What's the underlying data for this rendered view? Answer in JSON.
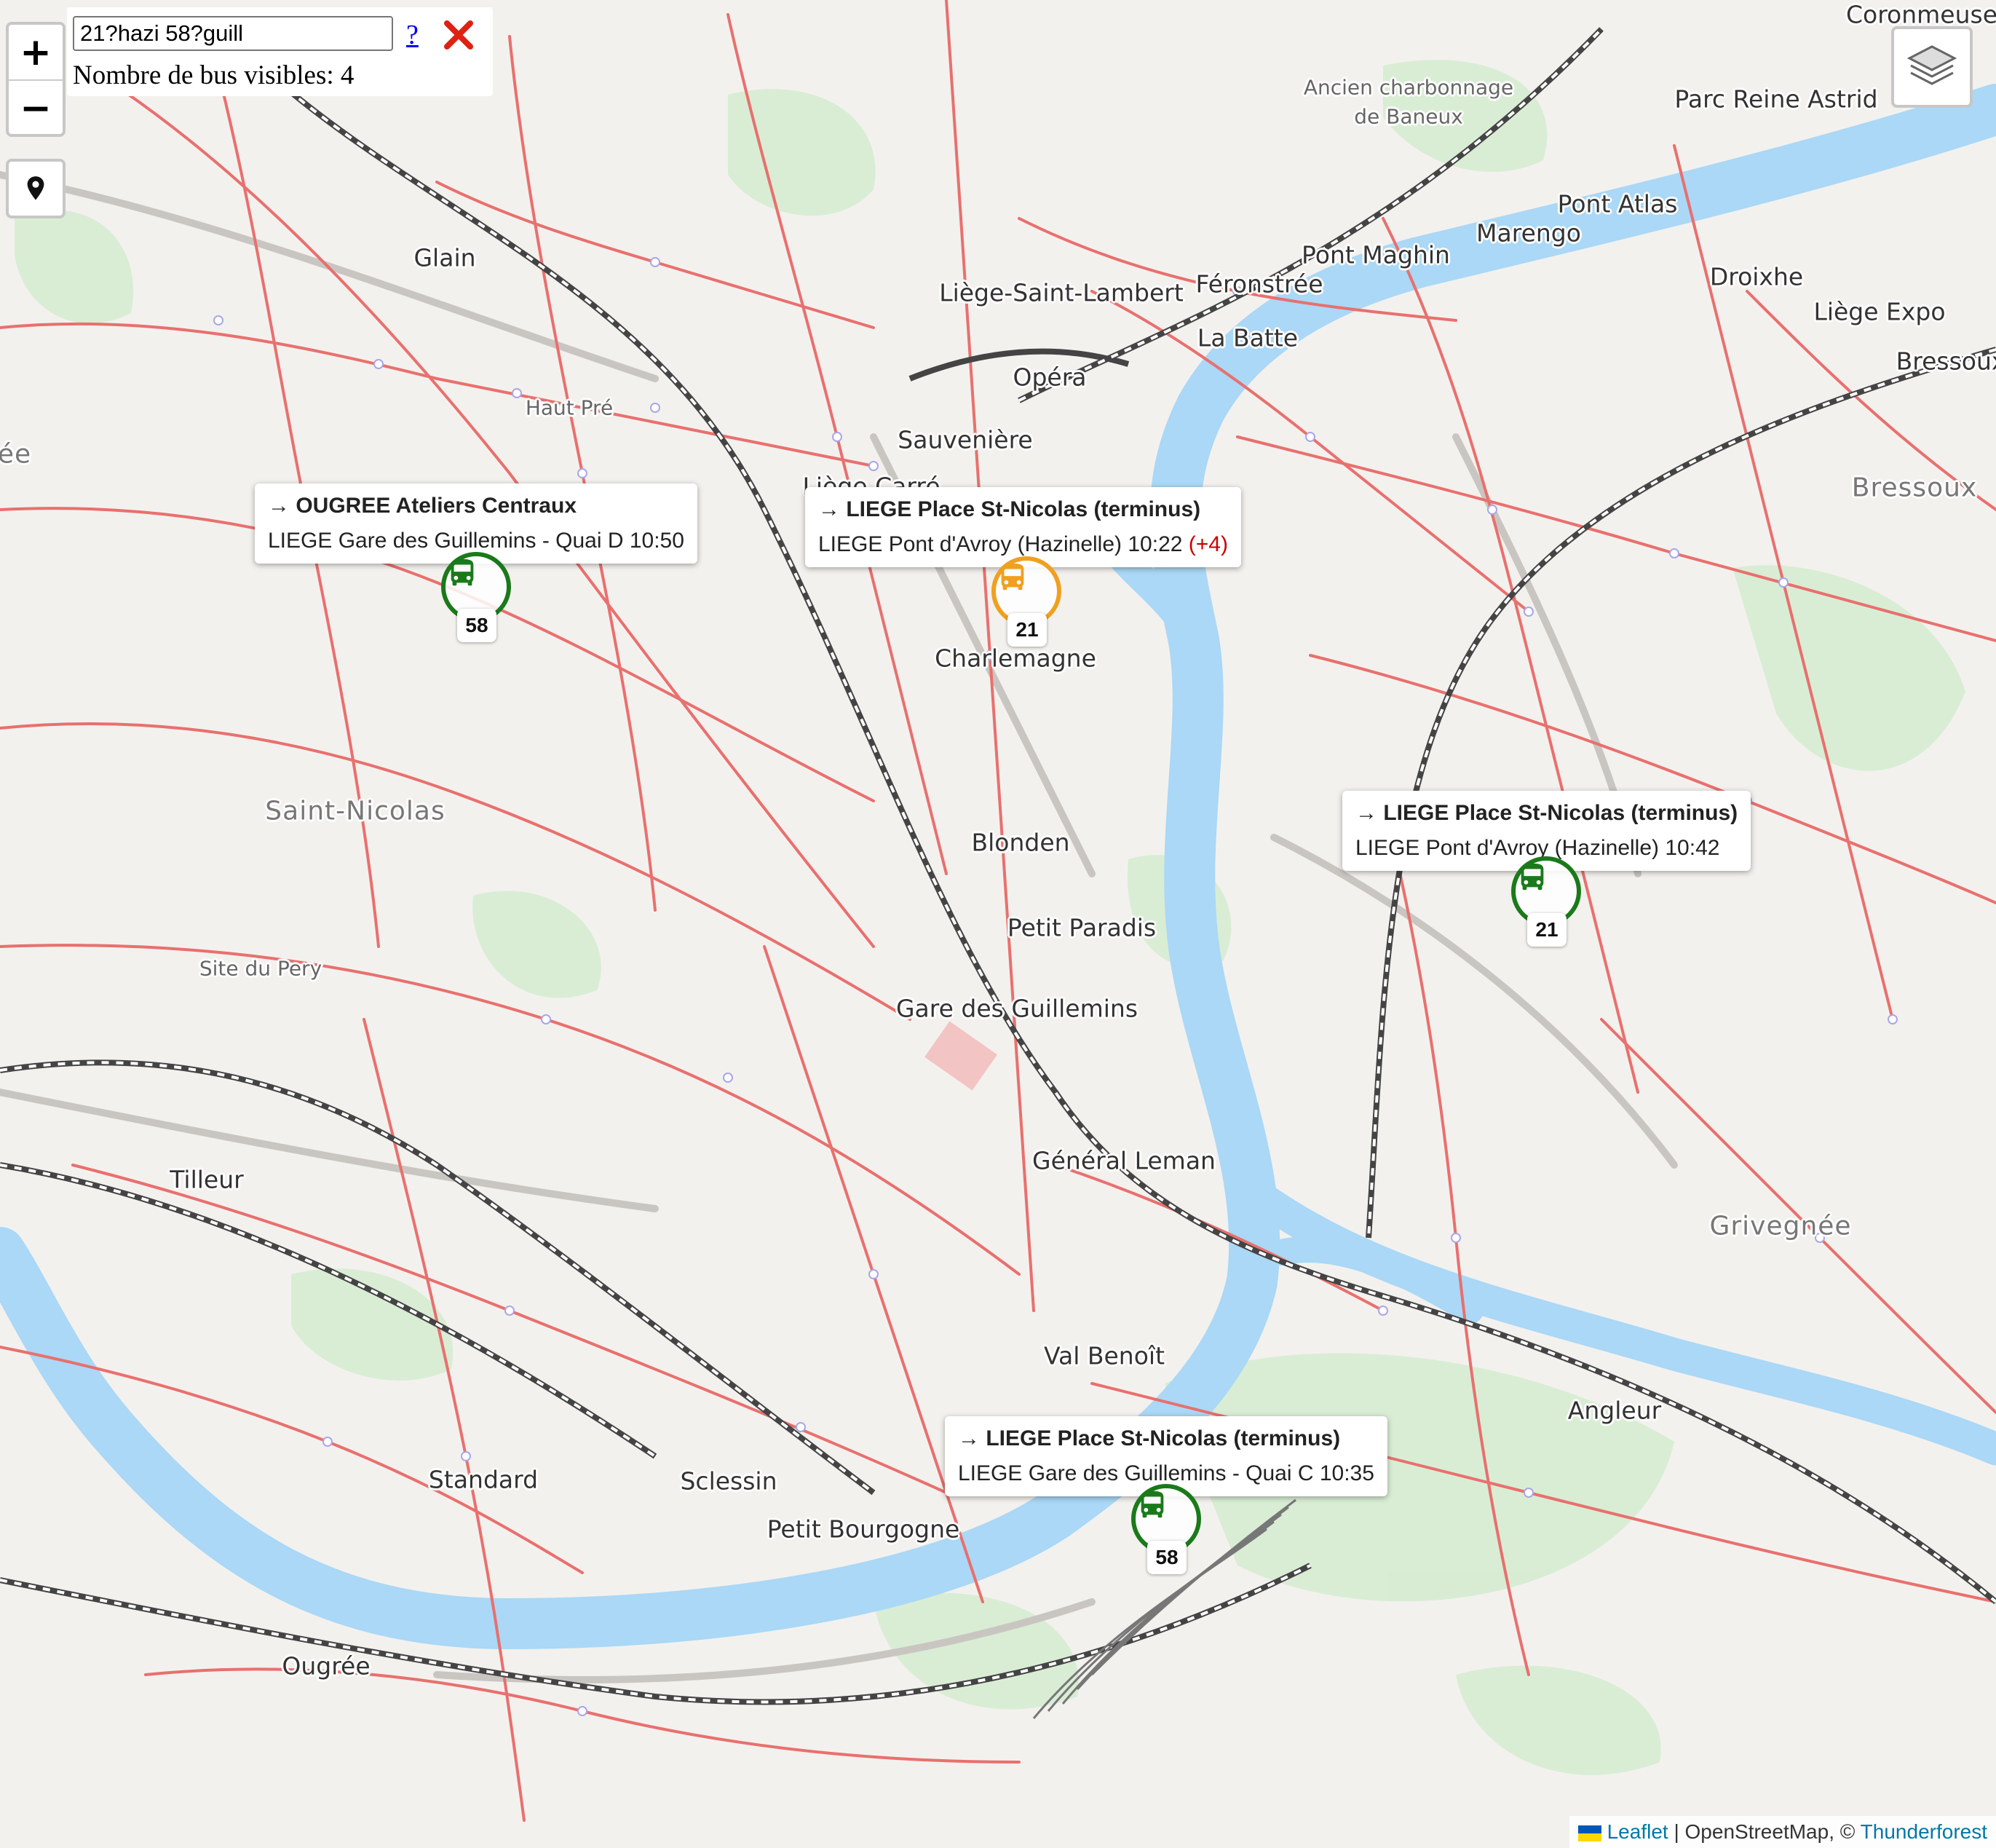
{
  "search": {
    "value": "21?hazi 58?guill",
    "help_label": "?"
  },
  "bus_count": {
    "label": "Nombre de bus visibles:",
    "value": "4"
  },
  "zoom": {
    "in_label": "+",
    "out_label": "−"
  },
  "icons": {
    "locate": "map-pin-icon",
    "layers": "layers-icon",
    "clear": "red-x-icon",
    "bus": "bus-icon"
  },
  "colors": {
    "route_line": "#e8706e",
    "river": "#aad8f6",
    "on_time": "#1a7a1a",
    "delayed": "#f0a020",
    "delay_text": "#cc0000"
  },
  "place_labels": [
    "Coronmeuse",
    "Ancien charbonnage",
    "de Baneux",
    "Parc Reine Astrid",
    "Pont Atlas",
    "Marengo",
    "Pont Maghin",
    "Droixhe",
    "Liège-Saint-Lambert",
    "Féronstrée",
    "Liège Expo",
    "Glain",
    "La Batte",
    "Bressoux",
    "Opéra",
    "Haut Pré",
    "Sauvenière",
    "Liège Carré",
    "Bressoux",
    "Charlemagne",
    "Saint-Nicolas",
    "Blonden",
    "Petit Paradis",
    "Site du Pery",
    "Gare des Guillemins",
    "Général Leman",
    "Tilleur",
    "Grivegnée",
    "Val Benoît",
    "Angleur",
    "Standard",
    "Sclessin",
    "Petit Bourgogne",
    "Ougrée",
    "ée"
  ],
  "buses": [
    {
      "route": "58",
      "status": "on-time",
      "destination": "→ OUGREE Ateliers Centraux",
      "stop": "LIEGE Gare des Guillemins - Quai D 10:50",
      "delay": ""
    },
    {
      "route": "21",
      "status": "delayed",
      "destination": "→ LIEGE Place St-Nicolas (terminus)",
      "stop": "LIEGE Pont d'Avroy (Hazinelle) 10:22",
      "delay": "(+4)"
    },
    {
      "route": "21",
      "status": "on-time",
      "destination": "→ LIEGE Place St-Nicolas (terminus)",
      "stop": "LIEGE Pont d'Avroy (Hazinelle) 10:42",
      "delay": ""
    },
    {
      "route": "58",
      "status": "on-time",
      "destination": "→ LIEGE Place St-Nicolas (terminus)",
      "stop": "LIEGE Gare des Guillemins - Quai C 10:35",
      "delay": ""
    }
  ],
  "attribution": {
    "leaflet": "Leaflet",
    "osm": "| OpenStreetMap, ©",
    "provider": "Thunderforest"
  }
}
